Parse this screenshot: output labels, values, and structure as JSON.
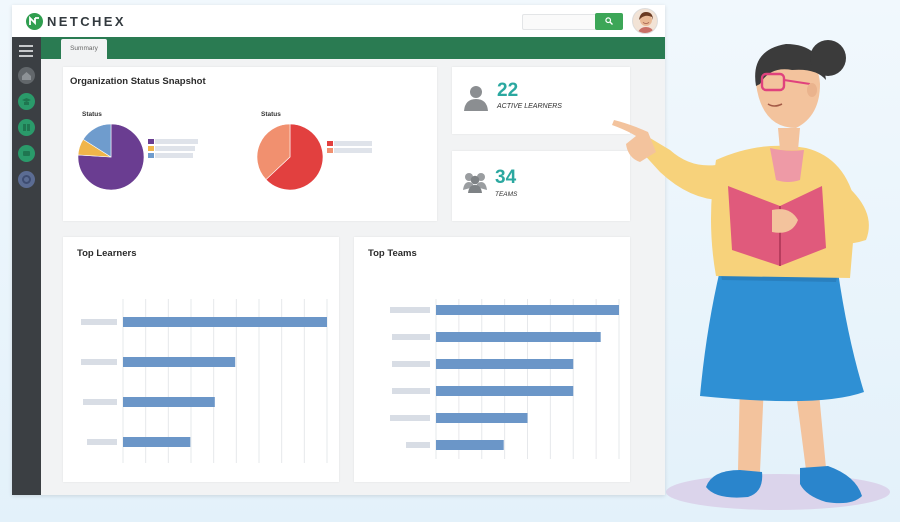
{
  "app": {
    "brand": "NETCHEX",
    "search": {
      "placeholder": ""
    },
    "active_tab": "Summary"
  },
  "sidebar": {
    "icons": [
      "menu-icon",
      "home-icon",
      "learning-icon",
      "reports-icon",
      "courses-icon",
      "settings-icon"
    ]
  },
  "org_status": {
    "title": "Organization Status Snapshot",
    "pies": [
      {
        "label": "Status",
        "slices": [
          0.76,
          0.08,
          0.16
        ],
        "colors": [
          "#6a3d91",
          "#f0b54a",
          "#6f9ccd"
        ]
      },
      {
        "label": "Status",
        "slices": [
          0.63,
          0.37
        ],
        "colors": [
          "#e2403f",
          "#f1906f"
        ]
      }
    ]
  },
  "stats": [
    {
      "value": "22",
      "label": "ACTIVE LEARNERS",
      "icon": "person-icon"
    },
    {
      "value": "34",
      "label": "TEAMS",
      "icon": "team-icon"
    }
  ],
  "top_learners": {
    "title": "Top Learners",
    "bars": [
      1.0,
      0.55,
      0.45,
      0.33
    ]
  },
  "top_teams": {
    "title": "Top Teams",
    "bars": [
      1.0,
      0.9,
      0.75,
      0.75,
      0.5,
      0.37
    ]
  },
  "colors": {
    "accent_green": "#2a7b52",
    "bar_blue": "#6b96c8",
    "stat_teal": "#2ba8a0"
  }
}
